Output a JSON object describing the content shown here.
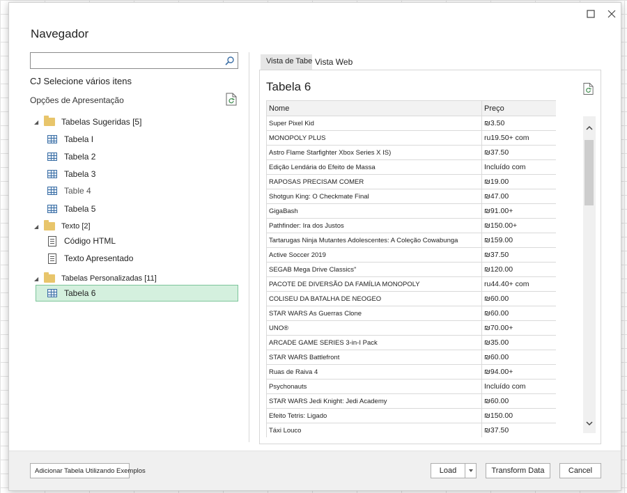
{
  "dialog": {
    "title": "Navegador"
  },
  "left": {
    "search_placeholder": "",
    "multi_select": "CJ Selecione vários itens",
    "display_options": "Opções de Apresentação",
    "tree": {
      "suggested": {
        "label": "Tabelas Sugeridas [5]",
        "items": [
          "Tabela I",
          "Tabela 2",
          "Tabela 3",
          "Table 4",
          "Tabela 5"
        ]
      },
      "text": {
        "label": "Texto [2]",
        "items": [
          "Código HTML",
          "Texto Apresentado"
        ]
      },
      "custom": {
        "label": "Tabelas Personalizadas [11]",
        "items": [
          "Tabela 6"
        ]
      }
    }
  },
  "right": {
    "tabs": [
      "Vista de Tabela",
      "Vista Web"
    ],
    "preview_title": "Tabela 6",
    "table": {
      "headers": [
        "Nome",
        "Preço"
      ],
      "rows": [
        [
          "Super Pixel Kid",
          "₪3.50"
        ],
        [
          "MONOPOLY PLUS",
          "ru19.50+ com"
        ],
        [
          "Astro Flame Starfighter Xbox Series X IS)",
          "₪37.50"
        ],
        [
          "Edição Lendária do Efeito de Massa",
          "Incluído com"
        ],
        [
          "RAPOSAS PRECISAM COMER",
          "₪19.00"
        ],
        [
          "Shotgun King: O Checkmate Final",
          "₪47.00"
        ],
        [
          "GigaBash",
          "₪91.00+"
        ],
        [
          "Pathfinder: Ira dos Justos",
          "₪150.00+"
        ],
        [
          "Tartarugas Ninja Mutantes Adolescentes: A Coleção Cowabunga",
          "₪159.00"
        ],
        [
          "Active Soccer 2019",
          "₪37.50"
        ],
        [
          "SEGAB Mega Drive Classics\"",
          "₪120.00"
        ],
        [
          "PACOTE DE DIVERSÃO DA FAMÍLIA MONOPOLY",
          "ru44.40+ com"
        ],
        [
          "COLISEU DA BATALHA DE NEOGEO",
          "₪60.00"
        ],
        [
          "STAR WARS As Guerras Clone",
          "₪60.00"
        ],
        [
          "UNO®",
          "₪70.00+"
        ],
        [
          "ARCADE GAME SERIES 3-in-I Pack",
          "₪35.00"
        ],
        [
          "STAR WARS Battlefront",
          "₪60.00"
        ],
        [
          "Ruas de Raiva 4",
          "₪94.00+"
        ],
        [
          "Psychonauts",
          "Incluído com"
        ],
        [
          "STAR WARS Jedi Knight: Jedi Academy",
          "₪60.00"
        ],
        [
          "Efeito Tetris: Ligado",
          "₪150.00"
        ],
        [
          "Táxi Louco",
          "₪37.50"
        ]
      ]
    }
  },
  "footer": {
    "add_table": "Adicionar Tabela Utilizando Exemplos",
    "load": "Load",
    "transform": "Transform Data",
    "cancel": "Cancel"
  }
}
